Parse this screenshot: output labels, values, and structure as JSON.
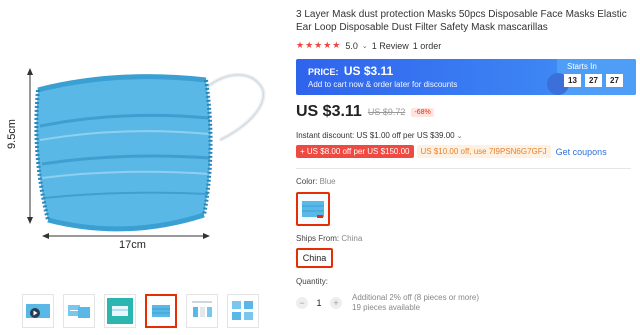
{
  "product": {
    "title": "3 Layer Mask dust protection Masks 50pcs Disposable Face Masks Elastic Ear Loop Disposable Dust Filter Safety Mask mascarillas",
    "rating_value": "5.0",
    "reviews_text": "1 Review",
    "orders_text": "1 order"
  },
  "gallery": {
    "height_label": "9.5cm",
    "width_label": "17cm",
    "thumbnails": [
      {
        "icon": "video-thumbnail-icon"
      },
      {
        "icon": "mask-packs-thumbnail-icon"
      },
      {
        "icon": "mask-teal-thumbnail-icon"
      },
      {
        "icon": "mask-blue-thumbnail-icon",
        "selected": true
      },
      {
        "icon": "mask-layers-thumbnail-icon"
      },
      {
        "icon": "mask-grid-thumbnail-icon"
      }
    ]
  },
  "promo": {
    "price_label": "PRICE:",
    "price": "US $3.11",
    "subtitle": "Add to cart now & order later for discounts",
    "starts_label": "Starts In",
    "timer": [
      "13",
      "27",
      "27"
    ]
  },
  "pricing": {
    "price": "US $3.11",
    "original_price": "US $9.72",
    "discount": "-68%"
  },
  "discounts": {
    "instant": "Instant discount: US $1.00 off per US $39.00",
    "coupon_red": "US $8.00 off per US $150.00",
    "coupon_red_prefix": "+",
    "coupon_orange": "US $10.00 off, use 7I9PSN6G7GFJ",
    "get_coupons": "Get coupons"
  },
  "options": {
    "color_label": "Color:",
    "color_value": "Blue",
    "ships_label": "Ships From:",
    "ships_value": "China",
    "ships_option": "China",
    "quantity_label": "Quantity:",
    "quantity_value": "1",
    "quantity_note_1": "Additional 2% off (8 pieces or more)",
    "quantity_note_2": "19 pieces available"
  },
  "colors": {
    "accent": "#e62e04",
    "promo_blue": "#2f63ec",
    "link_blue": "#2f6fd9",
    "mask_blue": "#5ab8e6"
  }
}
